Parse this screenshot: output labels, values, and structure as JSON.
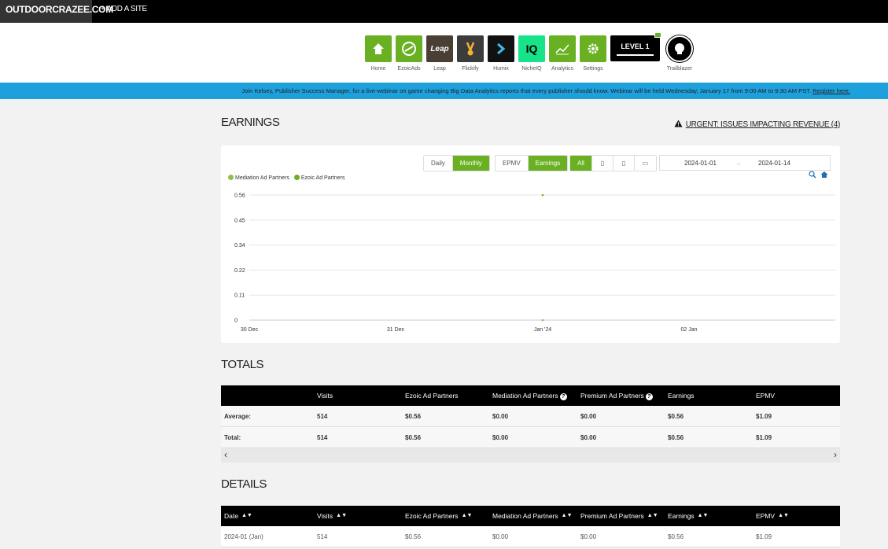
{
  "topbar": {
    "site": "OUTDOORCRAZEE.COM",
    "add_site": "+ ADD A SITE"
  },
  "apps": [
    {
      "label": "Home",
      "icon": "home-icon"
    },
    {
      "label": "EzoicAds",
      "icon": "ezoic-icon"
    },
    {
      "label": "Leap",
      "icon": "leap-icon",
      "tile_text": "Leap"
    },
    {
      "label": "Flickify",
      "icon": "flickify-icon"
    },
    {
      "label": "Humix",
      "icon": "humix-icon"
    },
    {
      "label": "NicheIQ",
      "icon": "nicheiq-icon",
      "tile_text": "IQ"
    },
    {
      "label": "Analytics",
      "icon": "analytics-icon"
    },
    {
      "label": "Settings",
      "icon": "gear-icon"
    }
  ],
  "level": {
    "text": "LEVEL 1"
  },
  "trailblazer": {
    "label": "Trailblazer"
  },
  "banner": {
    "text": "Join Kelsey, Publisher Success Manager, for a live-webinar on game changing Big Data Analytics reports that every publisher should know. Webinar will be held Wednesday, January 17 from 9:00 AM to 9:30 AM PST.",
    "link": "Register here."
  },
  "earnings": {
    "title": "EARNINGS",
    "urgent": "URGENT: ISSUES IMPACTING REVENUE (4)",
    "period_buttons": [
      "Daily",
      "Monthly"
    ],
    "period_active": "Monthly",
    "metric_buttons": [
      "EPMV",
      "Earnings"
    ],
    "metric_active": "Earnings",
    "device_buttons": [
      "All"
    ],
    "date_from": "2024-01-01",
    "date_sep": "→",
    "date_to": "2024-01-14"
  },
  "chart_data": {
    "type": "line",
    "series": [
      {
        "name": "Mediation Ad Partners",
        "color": "#8bc34a",
        "x": [
          "Jan '24"
        ],
        "values": [
          0
        ]
      },
      {
        "name": "Ezoic Ad Partners",
        "color": "#6ab023",
        "x": [
          "Jan '24"
        ],
        "values": [
          0.56
        ]
      }
    ],
    "x_ticks": [
      "30 Dec",
      "31 Dec",
      "Jan '24",
      "02 Jan"
    ],
    "y_ticks": [
      "0",
      "0.11",
      "0.22",
      "0.34",
      "0.45",
      "0.56"
    ],
    "ylim": [
      0,
      0.56
    ],
    "grid": true,
    "legend": "top-left"
  },
  "totals": {
    "title": "TOTALS",
    "headers": [
      "",
      "Visits",
      "Ezoic Ad Partners",
      "Mediation Ad Partners",
      "Premium Ad Partners",
      "Earnings",
      "EPMV"
    ],
    "rows": [
      [
        "Average:",
        "514",
        "$0.56",
        "$0.00",
        "$0.00",
        "$0.56",
        "$1.09"
      ],
      [
        "Total:",
        "514",
        "$0.56",
        "$0.00",
        "$0.00",
        "$0.56",
        "$1.09"
      ]
    ]
  },
  "details": {
    "title": "DETAILS",
    "headers": [
      "Date",
      "Visits",
      "Ezoic Ad Partners",
      "Mediation Ad Partners",
      "Premium Ad Partners",
      "Earnings",
      "EPMV"
    ],
    "rows": [
      [
        "2024-01 (Jan)",
        "514",
        "$0.56",
        "$0.00",
        "$0.00",
        "$0.56",
        "$1.09"
      ]
    ]
  }
}
